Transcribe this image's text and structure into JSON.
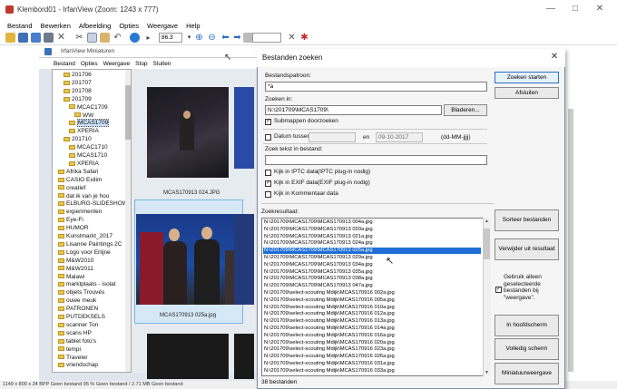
{
  "window": {
    "title": "Klembord01 - IrfanView (Zoom: 1243 x 777)",
    "minimize": "—",
    "maximize": "□",
    "close": "✕"
  },
  "menu": [
    "Bestand",
    "Bewerken",
    "Afbeelding",
    "Opties",
    "Weergave",
    "Help"
  ],
  "toolbar": {
    "zoom_value": "86.3"
  },
  "thumbnails_window": {
    "title": "IrfanView Miniaturen",
    "menu": [
      "Bestand",
      "Opties",
      "Weergave",
      "Stop",
      "Sluiten"
    ]
  },
  "tree": [
    {
      "label": "201706",
      "indent": 1
    },
    {
      "label": "201707",
      "indent": 1
    },
    {
      "label": "201708",
      "indent": 1
    },
    {
      "label": "201709",
      "indent": 1
    },
    {
      "label": "MCAC1709",
      "indent": 2
    },
    {
      "label": "WW",
      "indent": 3
    },
    {
      "label": "MCAS1709",
      "indent": 2,
      "selected": true
    },
    {
      "label": "XPERIA",
      "indent": 2
    },
    {
      "label": "201710",
      "indent": 1
    },
    {
      "label": "MCAC1710",
      "indent": 2
    },
    {
      "label": "MCAS1710",
      "indent": 2
    },
    {
      "label": "XPERIA",
      "indent": 2
    },
    {
      "label": "Afrika Safari",
      "indent": 0
    },
    {
      "label": "CASIO Exilim",
      "indent": 0
    },
    {
      "label": "creatief",
      "indent": 0
    },
    {
      "label": "dat ik van je hou",
      "indent": 0
    },
    {
      "label": "ELBURG-SLIDESHOW",
      "indent": 0
    },
    {
      "label": "experimenten",
      "indent": 0
    },
    {
      "label": "Eye-Fi",
      "indent": 0
    },
    {
      "label": "HUMOR",
      "indent": 0
    },
    {
      "label": "Kunstmarkt_2017",
      "indent": 0
    },
    {
      "label": "Lisanne Paintings 2C",
      "indent": 0
    },
    {
      "label": "Logo voor Erlijne",
      "indent": 0
    },
    {
      "label": "M&W2010",
      "indent": 0
    },
    {
      "label": "M&W2011",
      "indent": 0
    },
    {
      "label": "Malawi",
      "indent": 0
    },
    {
      "label": "marktplaats - isolat",
      "indent": 0
    },
    {
      "label": "objets Trouvés",
      "indent": 0
    },
    {
      "label": "ouwe meuk",
      "indent": 0
    },
    {
      "label": "PATRONEN",
      "indent": 0
    },
    {
      "label": "PUTDEKSELS",
      "indent": 0
    },
    {
      "label": "scanner Ton",
      "indent": 0
    },
    {
      "label": "scans HP",
      "indent": 0
    },
    {
      "label": "tablet foto's",
      "indent": 0
    },
    {
      "label": "tempi",
      "indent": 0
    },
    {
      "label": "Traveler",
      "indent": 0
    },
    {
      "label": "vriendschap",
      "indent": 0
    }
  ],
  "gallery": {
    "caption1": "MCAS170913 024.JPG",
    "caption2": "MCAS170913 025a.jpg"
  },
  "status": "1149 x 800 x 24 BPP    Geen bestand    95 %    Geen bestand / 2.71 MB    Geen bestand",
  "dialog": {
    "title": "Bestanden zoeken",
    "close": "✕",
    "pattern_label": "Bestandspatroon:",
    "pattern_value": "*a",
    "search_in_label": "Zoeken in:",
    "search_in_value": "N:\\201709\\MCAS1709\\",
    "browse": "Bladeren...",
    "subfolders": "Submappen doorzoeken",
    "date_between": "Datum tussen:",
    "and": "en",
    "date_to": "09-10-2017",
    "date_format": "(dd-MM-jjjj)",
    "text_label": "Zoek tekst in bestand:",
    "iptc": "Kijk in IPTC data",
    "iptc_note": "(IPTC plug-in nodig)",
    "exif": "Kijk in EXIF data",
    "exif_note": "(EXIF plug-in nodig)",
    "comment": "Kijk in Kommentaar data",
    "results_label": "Zoekresultaat:",
    "start": "Zoeken starten",
    "close_btn": "Afsluiten",
    "sort": "Sorteer bestanden",
    "remove": "Verwijder uit resultaat",
    "only_selected": "Gebruik alleen\ngeselecteerde\nbestanden bij\n\"weergave\".",
    "main_window": "In hoofdscherm",
    "fullscreen": "Volledig scherm",
    "thumbnail_view": "Miniatuurweergave",
    "count": "38 bestanden"
  },
  "results": [
    "N:\\201709\\MCAS1709\\MCAS170913 004a.jpg",
    "N:\\201709\\MCAS1709\\MCAS170913 020a.jpg",
    "N:\\201709\\MCAS1709\\MCAS170913 021a.jpg",
    "N:\\201709\\MCAS1709\\MCAS170913 024a.jpg",
    "N:\\201709\\MCAS1709\\MCAS170913 025a.jpg",
    "N:\\201709\\MCAS1709\\MCAS170913 029a.jpg",
    "N:\\201709\\MCAS1709\\MCAS170913 034a.jpg",
    "N:\\201709\\MCAS1709\\MCAS170913 035a.jpg",
    "N:\\201709\\MCAS1709\\MCAS170913 038a.jpg",
    "N:\\201709\\MCAS1709\\MCAS170913 047a.jpg",
    "N:\\201709\\select-scouting Mdijk\\MCAS170916 002a.jpg",
    "N:\\201709\\select-scouting Mdijk\\MCAS170916 005a.jpg",
    "N:\\201709\\select-scouting Mdijk\\MCAS170916 010a.jpg",
    "N:\\201709\\select-scouting Mdijk\\MCAS170916 012a.jpg",
    "N:\\201709\\select-scouting Mdijk\\MCAS170916 013a.jpg",
    "N:\\201709\\select-scouting Mdijk\\MCAS170916 014a.jpg",
    "N:\\201709\\select-scouting Mdijk\\MCAS170916 016a.jpg",
    "N:\\201709\\select-scouting Mdijk\\MCAS170916 020a.jpg",
    "N:\\201709\\select-scouting Mdijk\\MCAS170916 023a.jpg",
    "N:\\201709\\select-scouting Mdijk\\MCAS170916 026a.jpg",
    "N:\\201709\\select-scouting Mdijk\\MCAS170916 031a.jpg",
    "N:\\201709\\select-scouting Mdijk\\MCAS170916 033a.jpg"
  ],
  "selected_result": 4
}
